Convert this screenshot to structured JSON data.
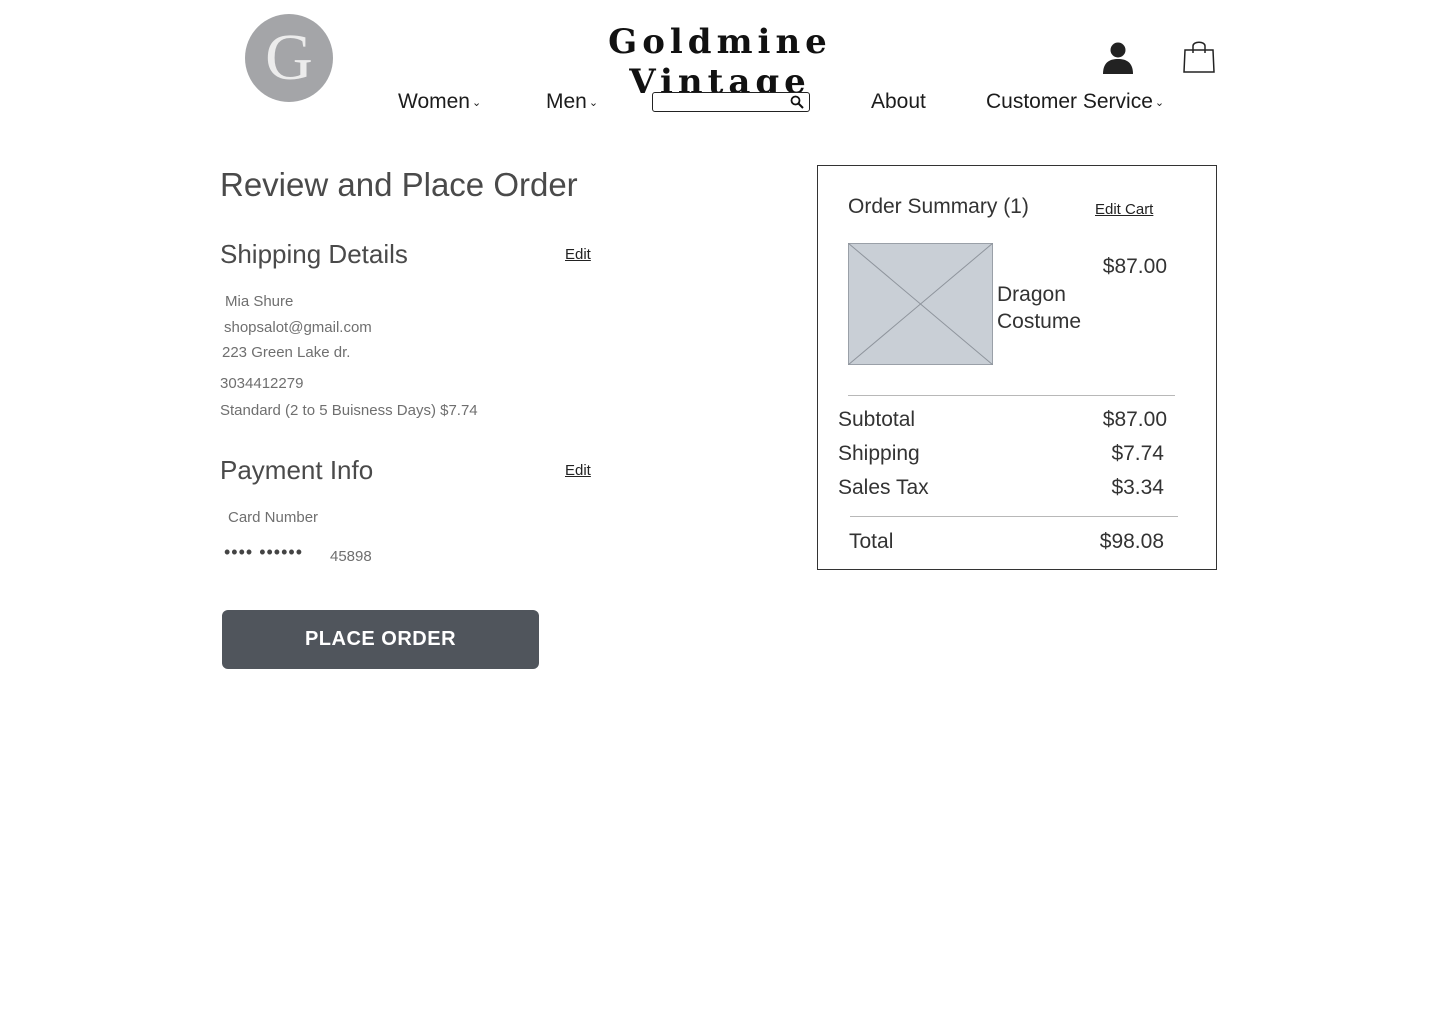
{
  "header": {
    "logo_letter": "G",
    "brand": "Goldmine Vintage",
    "nav": {
      "women": "Women",
      "men": "Men",
      "about": "About",
      "customer_service": "Customer Service"
    },
    "search": {
      "placeholder": "",
      "value": ""
    },
    "icons": {
      "user": "user-icon",
      "bag": "shopping-bag-icon",
      "search": "search-icon",
      "chevron": "chevron-down-icon"
    }
  },
  "page": {
    "title": "Review and Place Order"
  },
  "shipping": {
    "title": "Shipping Details",
    "edit_label": "Edit",
    "name": "Mia Shure",
    "email": "shopsalot@gmail.com",
    "address": "223 Green Lake dr.",
    "phone": "3034412279",
    "method": "Standard (2 to 5 Buisness Days) $7.74"
  },
  "payment": {
    "title": "Payment Info",
    "edit_label": "Edit",
    "card_label": "Card Number",
    "masked": "•••• ••••••",
    "card_suffix": "45898"
  },
  "actions": {
    "place_order": "PLACE ORDER"
  },
  "summary": {
    "title": "Order Summary (1)",
    "edit_cart": "Edit Cart",
    "item": {
      "name": "Dragon Costume",
      "price": "$87.00"
    },
    "subtotal_label": "Subtotal",
    "subtotal": "$87.00",
    "shipping_label": "Shipping",
    "shipping": "$7.74",
    "tax_label": "Sales Tax",
    "tax": "$3.34",
    "total_label": "Total",
    "total": "$98.08"
  },
  "colors": {
    "button_bg": "#50555c",
    "logo_circle": "#a4a5a8",
    "image_placeholder": "#c9cfd6"
  }
}
